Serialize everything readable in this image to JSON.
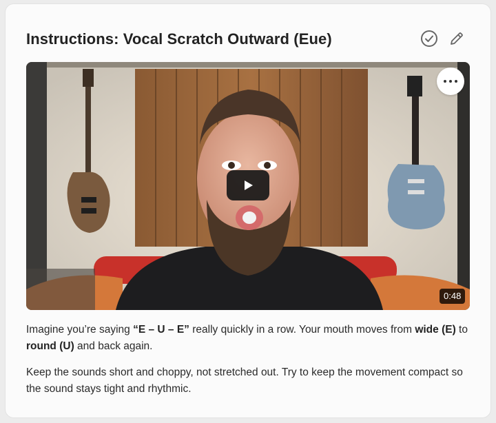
{
  "header": {
    "title": "Instructions: Vocal Scratch Outward (Eue)"
  },
  "icons": {
    "complete": "check-circle-icon",
    "edit": "pencil-icon",
    "more": "more-horizontal-icon",
    "play": "play-icon"
  },
  "video": {
    "duration": "0:48",
    "play_button_color": "#181818"
  },
  "instructions": {
    "p1_a": "Imagine you’re saying ",
    "p1_b": "“E – U – E”",
    "p1_c": " really quickly in a row. Your mouth moves from ",
    "p1_d": "wide (E)",
    "p1_e": " to ",
    "p1_f": "round (U)",
    "p1_g": " and back again.",
    "p2": "Keep the sounds short and choppy, not stretched out. Try to keep the movement compact so the sound stays tight and rhythmic."
  }
}
